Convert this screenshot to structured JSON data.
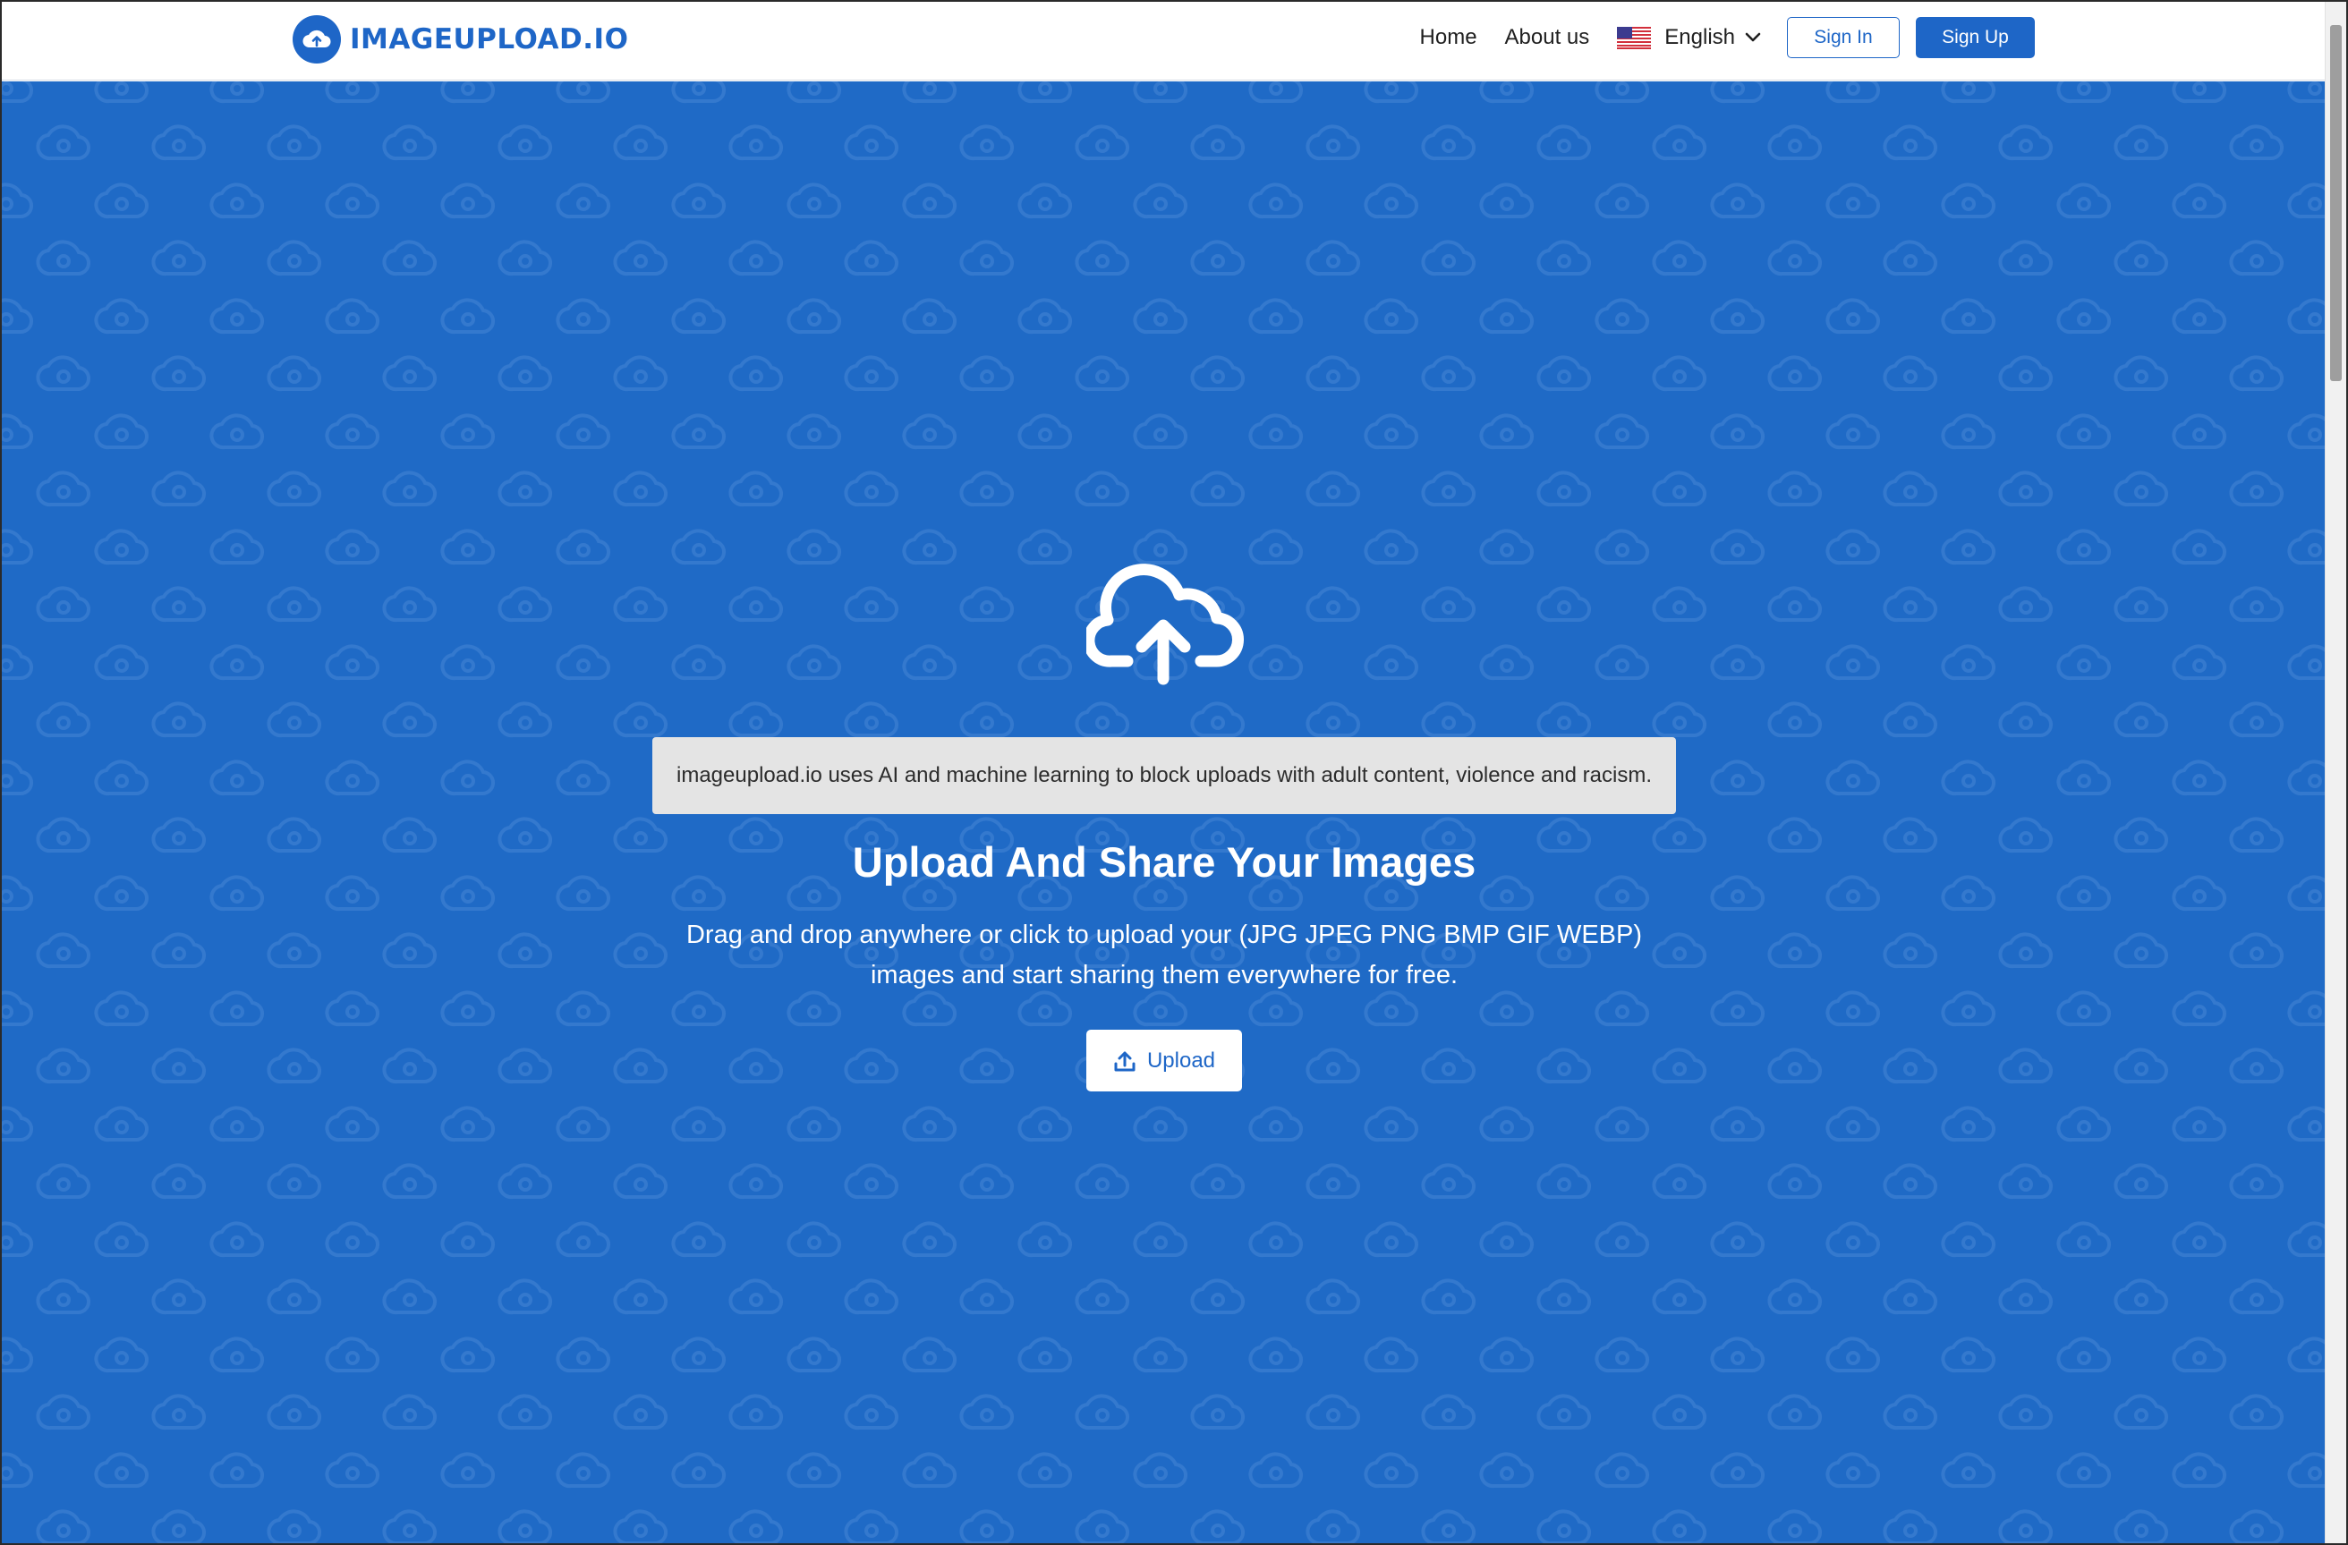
{
  "header": {
    "logo_text": "IMAGEUPLOAD.IO",
    "nav": {
      "home": "Home",
      "about": "About us"
    },
    "language": {
      "selected": "English",
      "flag_icon": "us-flag-icon"
    },
    "sign_in_label": "Sign In",
    "sign_up_label": "Sign Up"
  },
  "hero": {
    "notice": "imageupload.io uses AI and machine learning to block uploads with adult content, violence and racism.",
    "title": "Upload And Share Your Images",
    "description_line1": "Drag and drop anywhere or click to upload your (JPG JPEG PNG BMP GIF WEBP)",
    "description_line2": "images and start sharing them everywhere for free.",
    "upload_label": "Upload",
    "main_icon": "cloud-upload-icon"
  },
  "colors": {
    "brand": "#1e66c7",
    "hero_background": "#1f6ac6",
    "notice_background": "#e4e4e4"
  }
}
